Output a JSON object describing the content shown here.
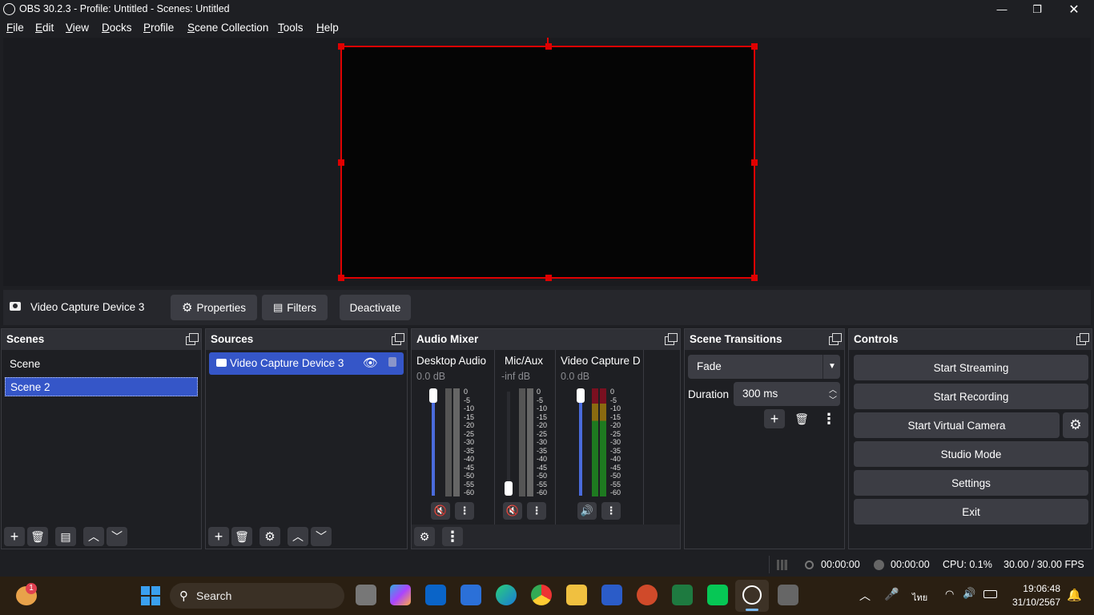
{
  "window": {
    "title": "OBS 30.2.3 - Profile: Untitled - Scenes: Untitled"
  },
  "menu": {
    "items": [
      "File",
      "Edit",
      "View",
      "Docks",
      "Profile",
      "Scene Collection",
      "Tools",
      "Help"
    ]
  },
  "source_toolbar": {
    "source_name": "Video Capture Device 3",
    "properties_label": "Properties",
    "filters_label": "Filters",
    "deactivate_label": "Deactivate"
  },
  "scenes": {
    "title": "Scenes",
    "items": [
      "Scene",
      "Scene 2"
    ],
    "selected": "Scene 2"
  },
  "sources": {
    "title": "Sources",
    "items": [
      "Video Capture Device 3"
    ]
  },
  "audio_mixer": {
    "title": "Audio Mixer",
    "channels": [
      {
        "name": "Desktop Audio",
        "level": "0.0 dB",
        "muted": true
      },
      {
        "name": "Mic/Aux",
        "level": "-inf dB",
        "muted": true
      },
      {
        "name": "Video Capture D",
        "level": "0.0 dB",
        "muted": false
      }
    ],
    "scale": [
      "0",
      "-5",
      "-10",
      "-15",
      "-20",
      "-25",
      "-30",
      "-35",
      "-40",
      "-45",
      "-50",
      "-55",
      "-60"
    ]
  },
  "scene_transitions": {
    "title": "Scene Transitions",
    "transition": "Fade",
    "duration_label": "Duration",
    "duration_value": "300 ms"
  },
  "controls": {
    "title": "Controls",
    "start_streaming": "Start Streaming",
    "start_recording": "Start Recording",
    "start_virtual_camera": "Start Virtual Camera",
    "studio_mode": "Studio Mode",
    "settings": "Settings",
    "exit": "Exit"
  },
  "status": {
    "stream_time": "00:00:00",
    "record_time": "00:00:00",
    "cpu": "CPU: 0.1%",
    "fps": "30.00 / 30.00 FPS"
  },
  "taskbar": {
    "search_placeholder": "Search",
    "time": "19:06:48",
    "date": "31/10/2567",
    "lang": "ไทย",
    "weather_badge": "1"
  },
  "colors": {
    "accent": "#3556c8",
    "selection_border": "#e00000",
    "mute": "#d0303a"
  }
}
